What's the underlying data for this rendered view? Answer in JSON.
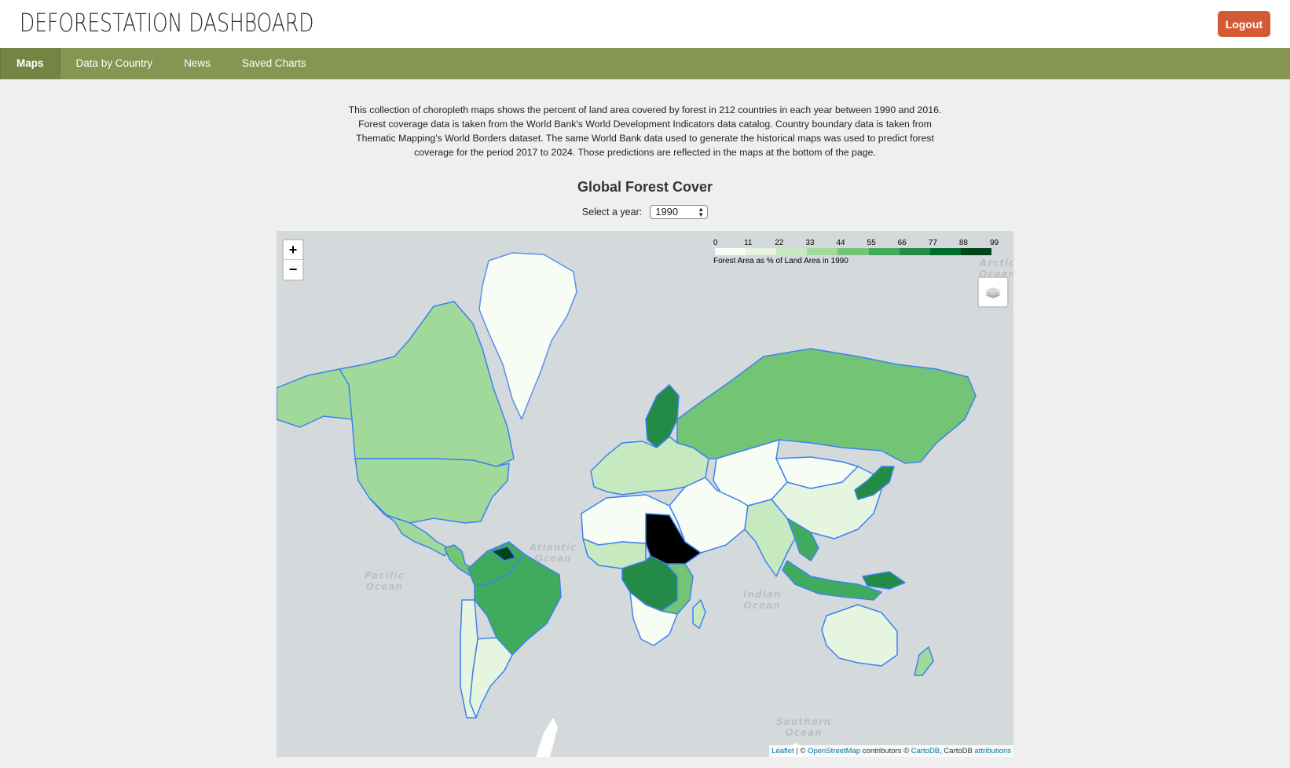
{
  "header": {
    "title": "DEFORESTATION DASHBOARD",
    "logout_label": "Logout"
  },
  "nav": {
    "tabs": [
      {
        "label": "Maps",
        "active": true
      },
      {
        "label": "Data by Country",
        "active": false
      },
      {
        "label": "News",
        "active": false
      },
      {
        "label": "Saved Charts",
        "active": false
      }
    ]
  },
  "intro": "This collection of choropleth maps shows the percent of land area covered by forest in 212 countries in each year between 1990 and 2016. Forest coverage data is taken from the World Bank's World Development Indicators data catalog. Country boundary data is taken from Thematic Mapping's World Borders dataset. The same World Bank data used to generate the historical maps was used to predict forest coverage for the period 2017 to 2024. Those predictions are reflected in the maps at the bottom of the page.",
  "map_section": {
    "title": "Global Forest Cover",
    "select_label": "Select a year:",
    "selected_year": "1990"
  },
  "map": {
    "zoom_in": "+",
    "zoom_out": "−",
    "layers_icon": "layers-icon",
    "legend": {
      "ticks": [
        "0",
        "11",
        "22",
        "33",
        "44",
        "55",
        "66",
        "77",
        "88",
        "99"
      ],
      "colors": [
        "#f7fcf5",
        "#e5f5e0",
        "#c7e9c0",
        "#a1d99b",
        "#74c476",
        "#41ab5d",
        "#238b45",
        "#006d2c",
        "#00441b"
      ],
      "caption": "Forest Area as % of Land Area in 1990"
    },
    "oceans": {
      "atlantic": "Atlantic\nOcean",
      "pacific": "Pacific\nOcean",
      "indian": "Indian\nOcean",
      "southern": "Southern\nOcean",
      "arctic": "Arctic\nOcean"
    },
    "attribution": {
      "leaflet": "Leaflet",
      "sep": " | © ",
      "osm": "OpenStreetMap",
      "contrib": " contributors © ",
      "cartodb": "CartoDB",
      "cartodb2": ", CartoDB ",
      "attributions": "attributions"
    },
    "regions": [
      {
        "name": "canada",
        "pct": 38
      },
      {
        "name": "alaska",
        "pct": 33
      },
      {
        "name": "usa",
        "pct": 33
      },
      {
        "name": "mexico",
        "pct": 36
      },
      {
        "name": "central-america",
        "pct": 50
      },
      {
        "name": "greenland",
        "pct": 0
      },
      {
        "name": "brazil",
        "pct": 65
      },
      {
        "name": "south-america-north",
        "pct": 60
      },
      {
        "name": "guyana-suriname",
        "pct": 95
      },
      {
        "name": "argentina",
        "pct": 11
      },
      {
        "name": "chile",
        "pct": 20
      },
      {
        "name": "russia",
        "pct": 49
      },
      {
        "name": "scandinavia",
        "pct": 70
      },
      {
        "name": "europe",
        "pct": 30
      },
      {
        "name": "china",
        "pct": 17
      },
      {
        "name": "central-asia",
        "pct": 3
      },
      {
        "name": "mongolia",
        "pct": 7
      },
      {
        "name": "middle-east",
        "pct": 2
      },
      {
        "name": "india",
        "pct": 22
      },
      {
        "name": "southeast-asia",
        "pct": 55
      },
      {
        "name": "indonesia",
        "pct": 65
      },
      {
        "name": "japan-korea",
        "pct": 68
      },
      {
        "name": "north-africa",
        "pct": 2
      },
      {
        "name": "west-africa",
        "pct": 25
      },
      {
        "name": "central-africa",
        "pct": 68
      },
      {
        "name": "east-africa-south",
        "pct": 45
      },
      {
        "name": "sudan-ethiopia",
        "pct": 99
      },
      {
        "name": "southern-africa",
        "pct": 8
      },
      {
        "name": "madagascar",
        "pct": 24
      },
      {
        "name": "australia",
        "pct": 16
      },
      {
        "name": "new-zealand",
        "pct": 38
      },
      {
        "name": "papua",
        "pct": 75
      }
    ]
  }
}
